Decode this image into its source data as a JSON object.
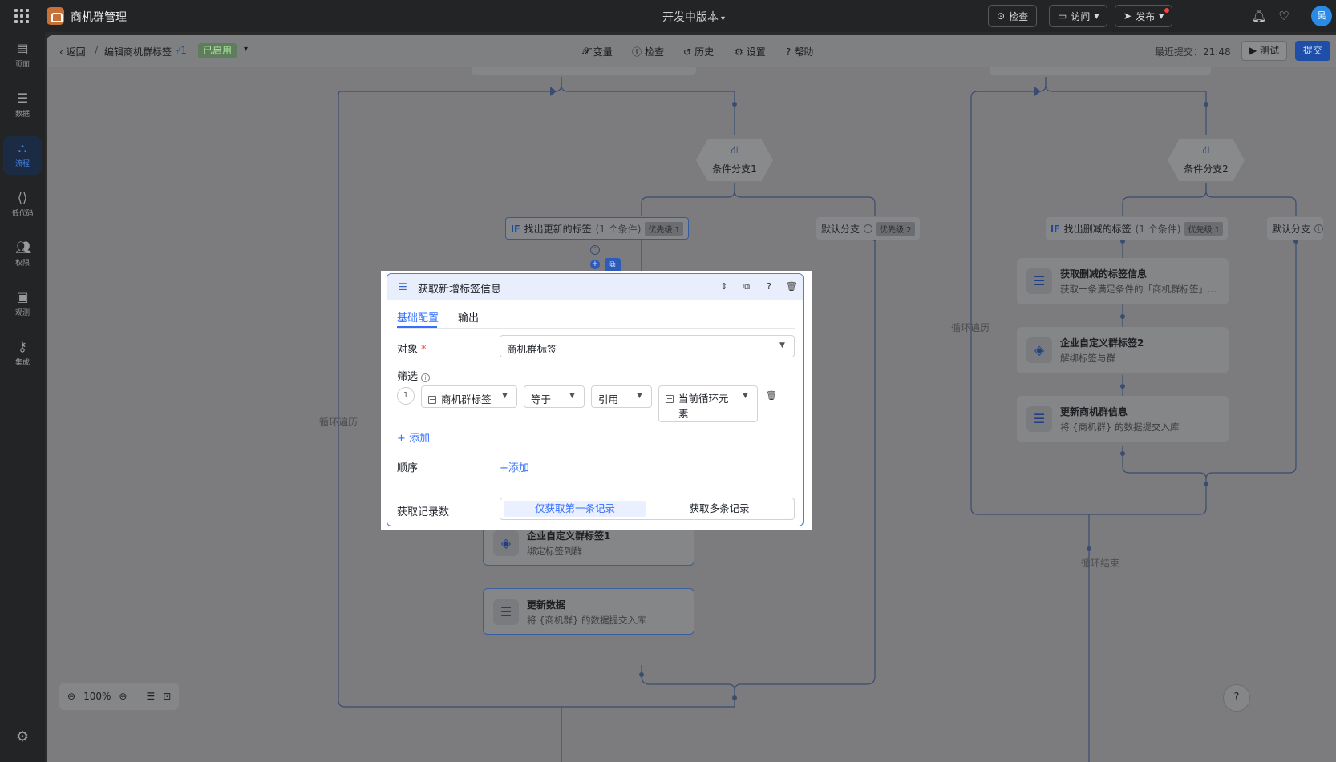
{
  "topbar": {
    "app_title": "商机群管理",
    "version": "开发中版本",
    "btn_check": "检查",
    "btn_visit": "访问",
    "btn_publish": "发布",
    "avatar_text": "吴"
  },
  "rail": {
    "items": [
      {
        "label": "页面",
        "icon": "page-icon"
      },
      {
        "label": "数据",
        "icon": "database-icon"
      },
      {
        "label": "流程",
        "icon": "flow-icon"
      },
      {
        "label": "低代码",
        "icon": "code-icon"
      },
      {
        "label": "权限",
        "icon": "users-icon"
      },
      {
        "label": "观测",
        "icon": "monitor-icon"
      },
      {
        "label": "集成",
        "icon": "key-icon"
      }
    ]
  },
  "subbar": {
    "back": "返回",
    "crumb": "编辑商机群标签",
    "crumb_num": "1",
    "status": "已启用",
    "menu": [
      "变量",
      "检查",
      "历史",
      "设置",
      "帮助"
    ],
    "last_submit": "最近提交：21:48",
    "test": "测试",
    "submit": "提交"
  },
  "flow": {
    "loop_left": "循环遍历",
    "loop_right": "循环遍历",
    "loop_end": "循环结束",
    "branch1": "条件分支1",
    "branch2": "条件分支2",
    "if1_title": "找出更新的标签",
    "if1_count": "(1 个条件)",
    "if1_prio": "优先级 1",
    "default1": "默认分支",
    "default1_prio": "优先级 2",
    "if2_title": "找出删减的标签",
    "if2_count": "(1 个条件)",
    "if2_prio": "优先级 1",
    "default2": "默认分支",
    "if_tag": "IF",
    "nodes": [
      {
        "title": "企业自定义群标签1",
        "sub": "绑定标签到群"
      },
      {
        "title": "更新数据",
        "sub": "将 {商机群} 的数据提交入库"
      },
      {
        "title": "获取删减的标签信息",
        "sub": "获取一条满足条件的「商机群标签」..."
      },
      {
        "title": "企业自定义群标签2",
        "sub": "解绑标签与群"
      },
      {
        "title": "更新商机群信息",
        "sub": "将 {商机群} 的数据提交入库"
      }
    ],
    "zoom": "100%"
  },
  "popup": {
    "title": "获取新增标签信息",
    "tab_basic": "基础配置",
    "tab_output": "输出",
    "object_label": "对象",
    "object_value": "商机群标签",
    "filter_label": "筛选",
    "filter_index": "1",
    "filter_field": "商机群标签",
    "filter_op": "等于",
    "filter_mode": "引用",
    "filter_value_line1": "当前循环元",
    "filter_value_line2": "素",
    "add": "添加",
    "order_label": "顺序",
    "order_add": "添加",
    "count_label": "获取记录数",
    "opt_first": "仅获取第一条记录",
    "opt_multi": "获取多条记录"
  },
  "colors": {
    "accent": "#3370ff",
    "submit": "#1e4ea8",
    "status_green": "#a8e49d"
  }
}
